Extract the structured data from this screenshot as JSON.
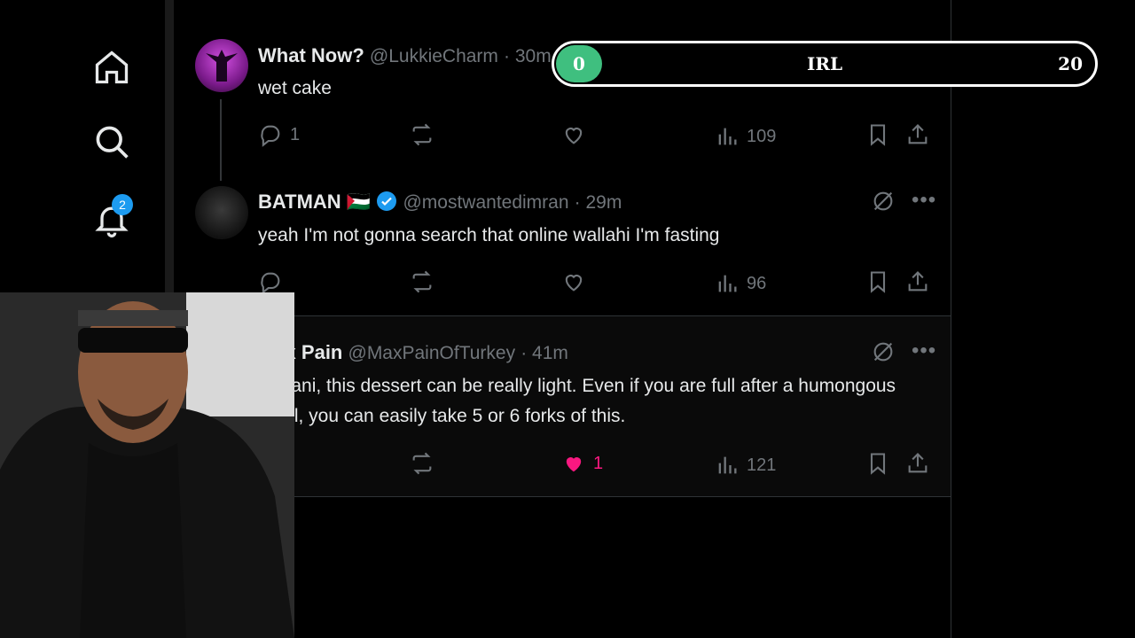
{
  "nav": {
    "notifications_badge": "2"
  },
  "progress": {
    "start": "0",
    "label": "IRL",
    "end": "20",
    "value_fraction": 0.0,
    "fill_color": "#3fbf7f"
  },
  "tweets": [
    {
      "name": "What Now?",
      "handle": "@LukkieCharm",
      "time": "30m",
      "text": "wet cake",
      "replies": "1",
      "likes": "",
      "views": "109"
    },
    {
      "name": "BATMAN",
      "flag": "🇵🇸",
      "handle": "@mostwantedimran",
      "time": "29m",
      "text": "yeah I'm not gonna search that online wallahi I'm fasting",
      "replies": "",
      "likes": "",
      "views": "96"
    },
    {
      "name": "Max Pain",
      "handle": "@MaxPainOfTurkey",
      "time": "41m",
      "text": "Revani, this dessert can be really light. Even if you are full after a humongous meal, you can easily take 5 or 6 forks of this.",
      "replies": "",
      "likes": "1",
      "views": "121"
    }
  ],
  "colors": {
    "accent": "#1d9bf0",
    "like_active": "#f91880",
    "muted": "#71767b"
  }
}
